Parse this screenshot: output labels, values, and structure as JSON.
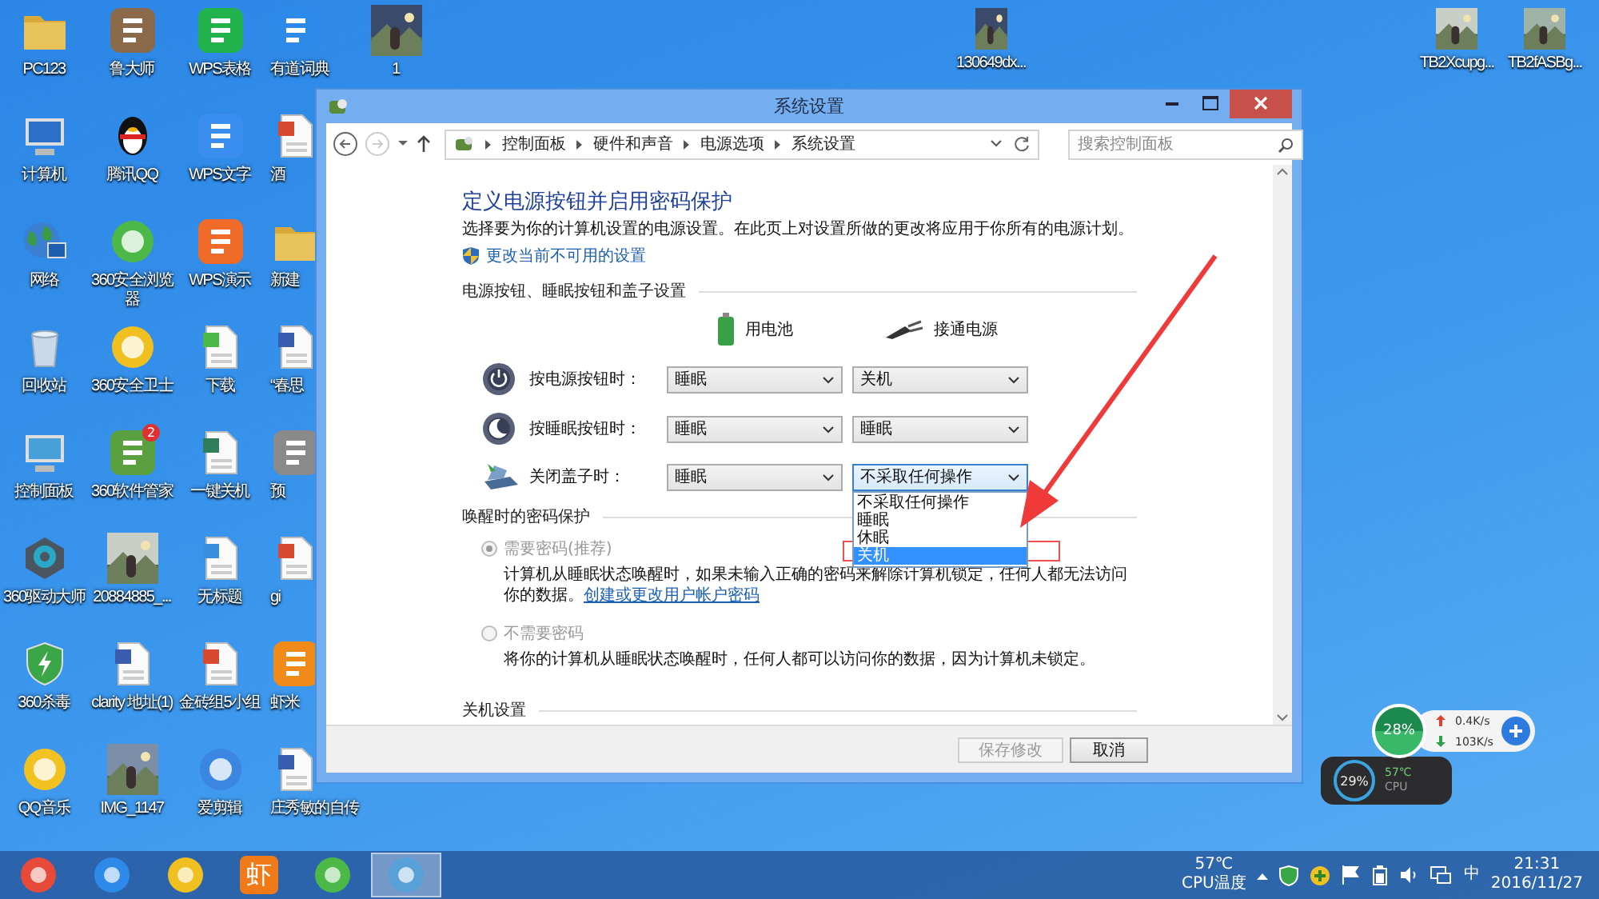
{
  "desktop": {
    "icons": [
      {
        "label": "PC123",
        "kind": "icon"
      },
      {
        "label": "计算机",
        "kind": "icon"
      },
      {
        "label": "网络",
        "kind": "icon"
      },
      {
        "label": "回收站",
        "kind": "icon"
      },
      {
        "label": "控制面板",
        "kind": "icon"
      },
      {
        "label": "360驱动大师",
        "kind": "icon"
      },
      {
        "label": "360杀毒",
        "kind": "icon"
      },
      {
        "label": "QQ音乐",
        "kind": "icon"
      },
      {
        "label": "鲁大师",
        "kind": "icon"
      },
      {
        "label": "腾讯QQ",
        "kind": "icon"
      },
      {
        "label": "360安全浏览器",
        "kind": "icon"
      },
      {
        "label": "360安全卫士",
        "kind": "icon"
      },
      {
        "label": "360软件管家",
        "kind": "icon",
        "badge": "2"
      },
      {
        "label": "20884885_...",
        "kind": "picture"
      },
      {
        "label": "clarity 地址(1)",
        "kind": "icon"
      },
      {
        "label": "IMG_1147",
        "kind": "picture"
      },
      {
        "label": "WPS表格",
        "kind": "icon"
      },
      {
        "label": "WPS文字",
        "kind": "icon"
      },
      {
        "label": "WPS演示",
        "kind": "icon"
      },
      {
        "label": "下载",
        "kind": "icon"
      },
      {
        "label": "一键关机",
        "kind": "icon"
      },
      {
        "label": "无标题",
        "kind": "icon"
      },
      {
        "label": "金砖组5小组",
        "kind": "icon"
      },
      {
        "label": "爱剪辑",
        "kind": "icon"
      },
      {
        "label": "有道词典",
        "kind": "icon"
      },
      {
        "label": "酒",
        "kind": "icon"
      },
      {
        "label": "新建",
        "kind": "icon"
      },
      {
        "label": "“春思",
        "kind": "icon"
      },
      {
        "label": "预",
        "kind": "icon"
      },
      {
        "label": "gi",
        "kind": "icon"
      },
      {
        "label": "虾米",
        "kind": "icon"
      },
      {
        "label": "庄秀敏的自传",
        "kind": "icon"
      },
      {
        "label": "1",
        "kind": "picture"
      }
    ],
    "top_icons": [
      {
        "label": "130649dx...",
        "kind": "picture"
      },
      {
        "label": "TB2Xcupg...",
        "kind": "picture"
      },
      {
        "label": "TB2fASBg...",
        "kind": "picture"
      }
    ]
  },
  "window": {
    "title": "系统设置",
    "breadcrumb": [
      "控制面板",
      "硬件和声音",
      "电源选项",
      "系统设置"
    ],
    "search": {
      "placeholder": "搜索控制面板"
    },
    "heading": "定义电源按钮并启用密码保护",
    "description": "选择要为你的计算机设置的电源设置。在此页上对设置所做的更改将应用于你所有的电源计划。",
    "admin_link": "更改当前不可用的设置",
    "power_section": {
      "title": "电源按钮、睡眠按钮和盖子设置",
      "columns": [
        "用电池",
        "接通电源"
      ],
      "rows": [
        {
          "label": "按电源按钮时：",
          "battery": "睡眠",
          "plugged": "关机"
        },
        {
          "label": "按睡眠按钮时：",
          "battery": "睡眠",
          "plugged": "睡眠"
        },
        {
          "label": "关闭盖子时：",
          "battery": "睡眠",
          "plugged": "不采取任何操作",
          "plugged_options": [
            {
              "label": "不采取任何操作",
              "selected": false
            },
            {
              "label": "睡眠",
              "selected": false
            },
            {
              "label": "休眠",
              "selected": false
            },
            {
              "label": "关机",
              "selected": true
            }
          ]
        }
      ]
    },
    "password_section": {
      "title": "唤醒时的密码保护",
      "disabled": true,
      "options": [
        {
          "label": "需要密码(推荐)",
          "selected": true,
          "description": "计算机从睡眠状态唤醒时，如果未输入正确的密码来解除计算机锁定，任何人都无法访问你的数据。",
          "link": "创建或更改用户帐户密码"
        },
        {
          "label": "不需要密码",
          "selected": false,
          "description": "将你的计算机从睡眠状态唤醒时，任何人都可以访问你的数据，因为计算机未锁定。"
        }
      ]
    },
    "shutdown_section": {
      "title": "关机设置"
    },
    "footer_buttons": [
      {
        "label": "保存修改",
        "disabled": true
      },
      {
        "label": "取消",
        "disabled": false
      }
    ]
  },
  "gadgets": {
    "cpu_meter": "28%",
    "upload": "0.4K/s",
    "download": "103K/s",
    "second_meter": "29%",
    "temperature": "57℃",
    "temperature_label": "CPU"
  },
  "taskbar": {
    "apps": [
      {
        "selected": false
      },
      {
        "selected": false
      },
      {
        "selected": false
      },
      {
        "selected": false,
        "glyph": "虾"
      },
      {
        "selected": false
      },
      {
        "selected": true
      }
    ],
    "tray": {
      "temperature": "57℃",
      "temperature_label": "CPU温度",
      "ime": "中",
      "time": "21:31",
      "date": "2016/11/27"
    }
  }
}
